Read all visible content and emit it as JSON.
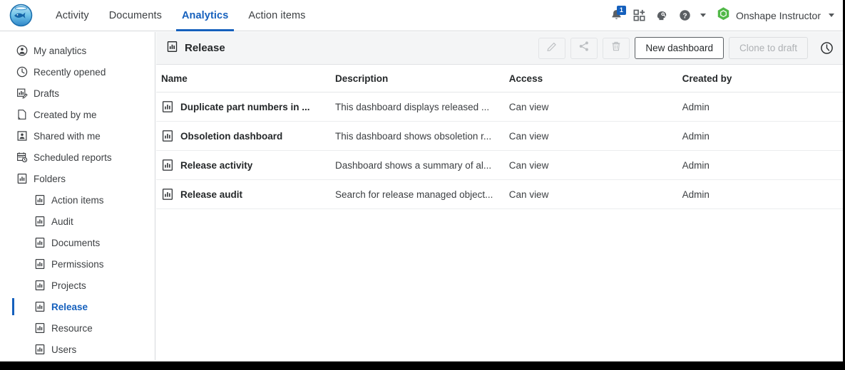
{
  "colors": {
    "accent_blue": "#1560bd",
    "badge_blue": "#1560bd",
    "onshape_green": "#51b848",
    "text_dark": "#25282a",
    "header_bg": "#f4f5f6"
  },
  "topbar": {
    "logo_name": "fishbowl-logo",
    "tabs": [
      {
        "label": "Activity",
        "active": false
      },
      {
        "label": "Documents",
        "active": false
      },
      {
        "label": "Analytics",
        "active": true
      },
      {
        "label": "Action items",
        "active": false
      }
    ],
    "icons": [
      {
        "name": "notifications-bell-icon",
        "badge": "1"
      },
      {
        "name": "app-store-grid-plus-icon",
        "badge": ""
      },
      {
        "name": "learning-center-brain-icon",
        "badge": ""
      },
      {
        "name": "help-question-icon",
        "badge": ""
      }
    ],
    "notification_count": "1",
    "user_name": "Onshape Instructor",
    "user_logo_name": "onshape-hex-logo"
  },
  "sidebar": {
    "items": [
      {
        "label": "My analytics",
        "icon": "person-circle-icon",
        "sub": false,
        "selected": false
      },
      {
        "label": "Recently opened",
        "icon": "clock-icon",
        "sub": false,
        "selected": false
      },
      {
        "label": "Drafts",
        "icon": "draft-chart-pencil-icon",
        "sub": false,
        "selected": false
      },
      {
        "label": "Created by me",
        "icon": "document-page-icon",
        "sub": false,
        "selected": false
      },
      {
        "label": "Shared with me",
        "icon": "shared-person-icon",
        "sub": false,
        "selected": false
      },
      {
        "label": "Scheduled reports",
        "icon": "calendar-clock-icon",
        "sub": false,
        "selected": false
      },
      {
        "label": "Folders",
        "icon": "dashboard-chart-icon",
        "sub": false,
        "selected": false
      },
      {
        "label": "Action items",
        "icon": "dashboard-chart-icon",
        "sub": true,
        "selected": false
      },
      {
        "label": "Audit",
        "icon": "dashboard-chart-icon",
        "sub": true,
        "selected": false
      },
      {
        "label": "Documents",
        "icon": "dashboard-chart-icon",
        "sub": true,
        "selected": false
      },
      {
        "label": "Permissions",
        "icon": "dashboard-chart-icon",
        "sub": true,
        "selected": false
      },
      {
        "label": "Projects",
        "icon": "dashboard-chart-icon",
        "sub": true,
        "selected": false
      },
      {
        "label": "Release",
        "icon": "dashboard-chart-icon",
        "sub": true,
        "selected": true
      },
      {
        "label": "Resource",
        "icon": "dashboard-chart-icon",
        "sub": true,
        "selected": false
      },
      {
        "label": "Users",
        "icon": "dashboard-chart-icon",
        "sub": true,
        "selected": false
      }
    ]
  },
  "content_header": {
    "title": "Release",
    "title_icon": "dashboard-chart-icon",
    "edit_icon": "pencil-icon",
    "share_icon": "share-icon",
    "delete_icon": "trash-icon",
    "new_dashboard_label": "New dashboard",
    "clone_to_draft_label": "Clone to draft",
    "clone_disabled": true,
    "history_icon": "history-clock-icon"
  },
  "table": {
    "columns": [
      "Name",
      "Description",
      "Access",
      "Created by"
    ],
    "rows": [
      {
        "icon": "dashboard-chart-icon",
        "name": "Duplicate part numbers in ...",
        "description": "This dashboard displays released ...",
        "access": "Can view",
        "created_by": "Admin"
      },
      {
        "icon": "dashboard-chart-icon",
        "name": "Obsoletion dashboard",
        "description": "This dashboard shows obsoletion r...",
        "access": "Can view",
        "created_by": "Admin"
      },
      {
        "icon": "dashboard-chart-icon",
        "name": "Release activity",
        "description": "Dashboard shows a summary of al...",
        "access": "Can view",
        "created_by": "Admin"
      },
      {
        "icon": "dashboard-chart-icon",
        "name": "Release audit",
        "description": "Search for release managed object...",
        "access": "Can view",
        "created_by": "Admin"
      }
    ]
  }
}
